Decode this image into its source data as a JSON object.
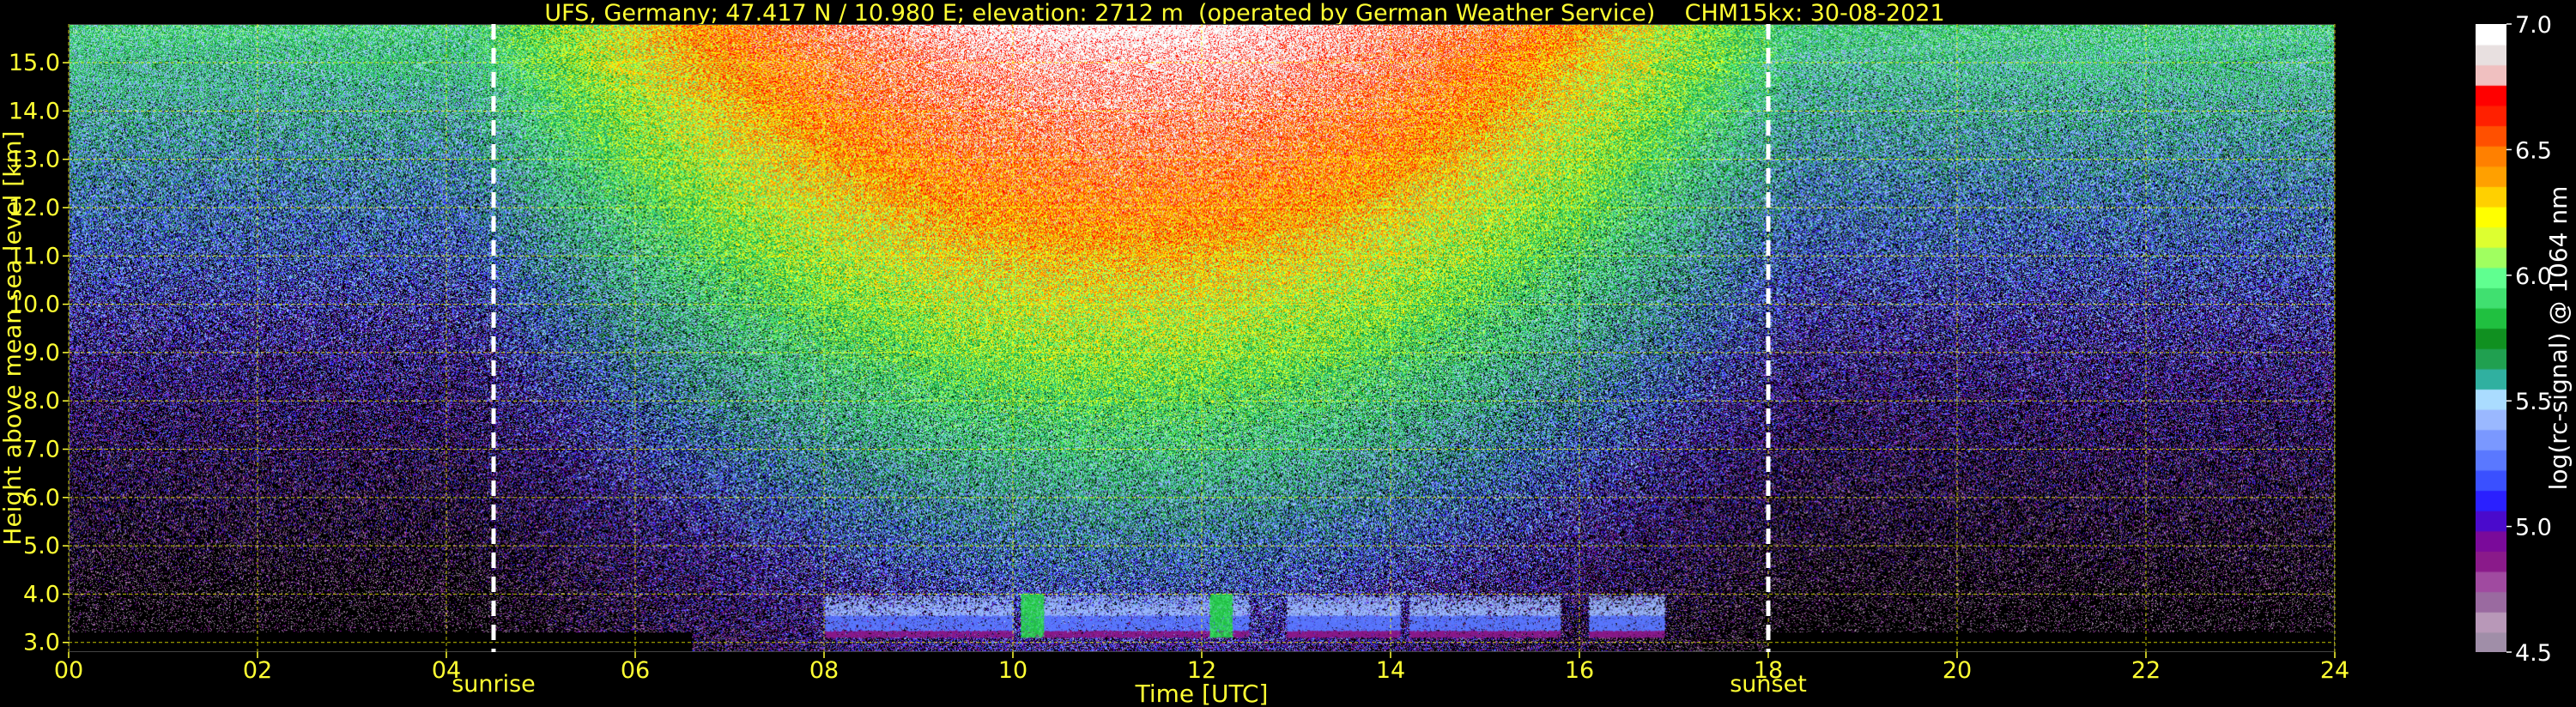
{
  "title": "UFS, Germany; 47.417 N / 10.980 E; elevation: 2712 m  (operated by German Weather Service)    CHM15kx: 30-08-2021",
  "colors": {
    "text": "#ffff33",
    "grid": "#ffff00",
    "background": "#000000",
    "marker_lines": "#ffffff",
    "colorbar_text": "#ffffff"
  },
  "chart_data": {
    "type": "heatmap",
    "title": "UFS, Germany; 47.417 N / 10.980 E; elevation: 2712 m  (operated by German Weather Service)    CHM15kx: 30-08-2021",
    "xlabel": "Time [UTC]",
    "ylabel": "Height above mean sea level [km]",
    "xlim": [
      0,
      24
    ],
    "ylim": [
      2.8,
      15.8
    ],
    "x_ticks": [
      "00",
      "02",
      "04",
      "06",
      "08",
      "10",
      "12",
      "14",
      "16",
      "18",
      "20",
      "22",
      "24"
    ],
    "y_ticks": [
      "3.0",
      "4.0",
      "5.0",
      "6.0",
      "7.0",
      "8.0",
      "9.0",
      "10.0",
      "11.0",
      "12.0",
      "13.0",
      "14.0",
      "15.0"
    ],
    "grid": true,
    "vertical_markers": [
      {
        "label": "sunrise",
        "x": 4.5
      },
      {
        "label": "sunset",
        "x": 18.0
      }
    ],
    "colorbar": {
      "label": "log(rc-signal) @ 1064 nm",
      "min": 4.5,
      "max": 7.0,
      "ticks": [
        "4.5",
        "5.0",
        "5.5",
        "6.0",
        "6.5",
        "7.0"
      ],
      "colors": [
        "#a08ea8",
        "#b898b8",
        "#9a6aa0",
        "#a04aa0",
        "#8a1a8a",
        "#7a0a9a",
        "#4a0acc",
        "#2a20ff",
        "#3a50ff",
        "#5a78ff",
        "#7a98ff",
        "#9ab8ff",
        "#aadcff",
        "#30b0a0",
        "#20a050",
        "#109020",
        "#20c040",
        "#40e070",
        "#60ff90",
        "#a0ff60",
        "#ddff30",
        "#ffff00",
        "#ffd000",
        "#ffa000",
        "#ff8000",
        "#ff5000",
        "#ff2000",
        "#ff0000",
        "#f0c0c0",
        "#e8e0e0",
        "#ffffff"
      ]
    },
    "cloud_layer": {
      "base_km": 3.1,
      "top_km": 4.0,
      "segments": [
        [
          10.1,
          10.5
        ],
        [
          10.5,
          12.5
        ],
        [
          8.0,
          10.0
        ],
        [
          12.9,
          14.1
        ],
        [
          14.2,
          15.8
        ],
        [
          16.1,
          16.9
        ]
      ],
      "strong_spots": [
        10.2,
        12.2
      ]
    }
  }
}
